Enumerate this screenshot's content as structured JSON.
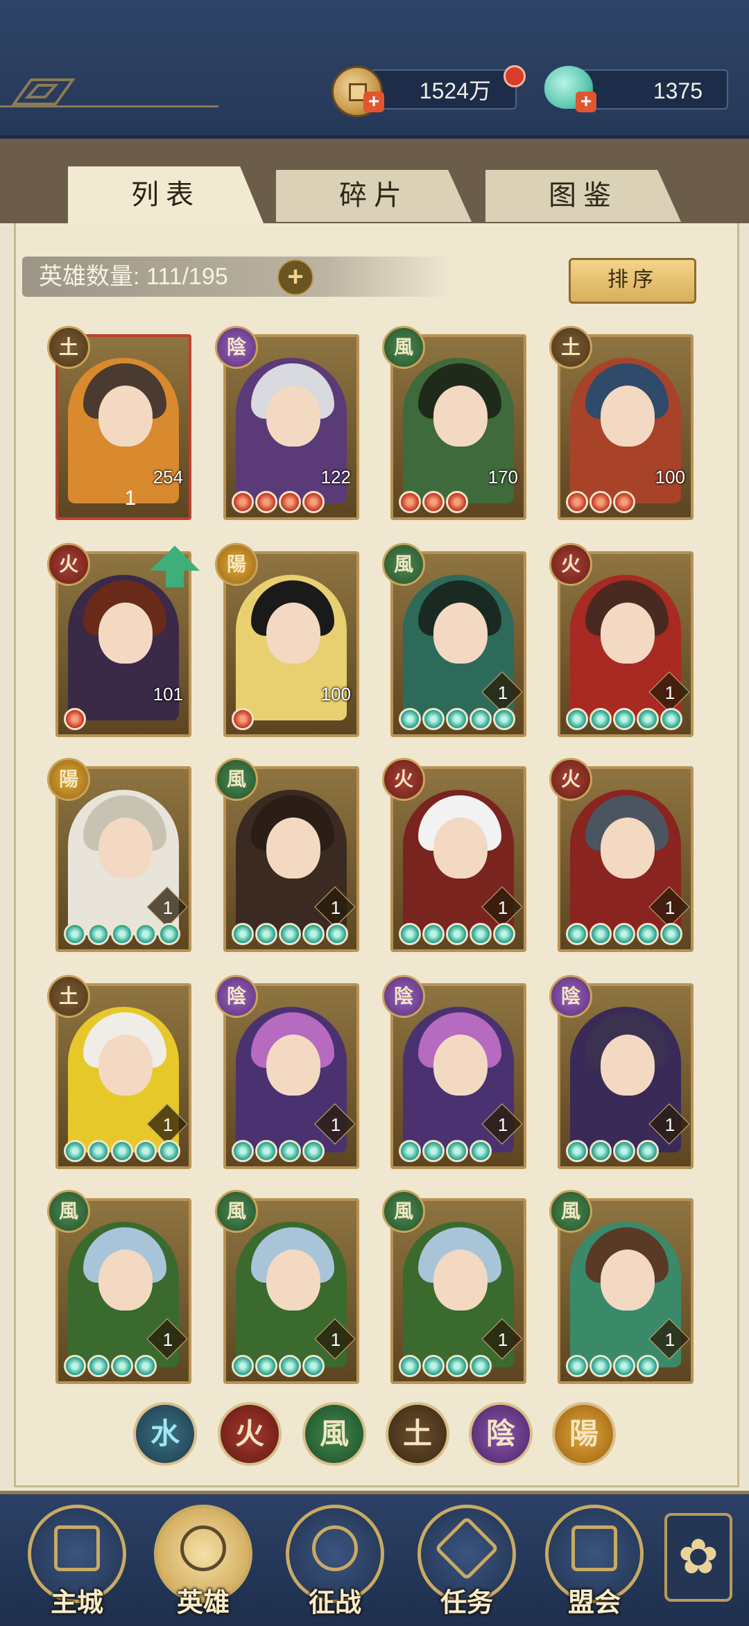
{
  "currency": {
    "coins": "1524万",
    "gems": "1375"
  },
  "tabs": [
    {
      "label": "列表",
      "active": true
    },
    {
      "label": "碎片",
      "active": false
    },
    {
      "label": "图鉴",
      "active": false
    }
  ],
  "hero_count": {
    "label": "英雄数量: 111/195"
  },
  "sort_button": {
    "label": "排序"
  },
  "elements": {
    "earth": "土",
    "yin": "陰",
    "wind": "風",
    "fire": "火",
    "yang": "陽",
    "water": "水"
  },
  "heroes": [
    {
      "element": "土",
      "level": "254",
      "stars": "1",
      "beads": [],
      "red_frame": true
    },
    {
      "element": "陰",
      "level": "122",
      "stars": "",
      "beads": [
        "red",
        "red",
        "red",
        "red"
      ]
    },
    {
      "element": "風",
      "level": "170",
      "stars": "",
      "beads": [
        "red",
        "red",
        "red"
      ]
    },
    {
      "element": "土",
      "level": "100",
      "stars": "",
      "beads": [
        "red",
        "red",
        "red"
      ]
    },
    {
      "element": "火",
      "level": "101",
      "stars": "",
      "beads": [
        "red"
      ],
      "upgrade": true
    },
    {
      "element": "陽",
      "level": "100",
      "stars": "",
      "beads": [
        "red"
      ]
    },
    {
      "element": "風",
      "level": "",
      "stars": "1",
      "beads": [
        "green",
        "green",
        "green",
        "green",
        "green"
      ]
    },
    {
      "element": "火",
      "level": "",
      "stars": "1",
      "beads": [
        "green",
        "green",
        "green",
        "green",
        "green"
      ]
    },
    {
      "element": "陽",
      "level": "",
      "stars": "1",
      "beads": [
        "green",
        "green",
        "green",
        "green",
        "green"
      ]
    },
    {
      "element": "風",
      "level": "",
      "stars": "1",
      "beads": [
        "green",
        "green",
        "green",
        "green",
        "green"
      ]
    },
    {
      "element": "火",
      "level": "",
      "stars": "1",
      "beads": [
        "green",
        "green",
        "green",
        "green",
        "green"
      ]
    },
    {
      "element": "火",
      "level": "",
      "stars": "1",
      "beads": [
        "green",
        "green",
        "green",
        "green",
        "green"
      ]
    },
    {
      "element": "土",
      "level": "",
      "stars": "1",
      "beads": [
        "green",
        "green",
        "green",
        "green",
        "green"
      ]
    },
    {
      "element": "陰",
      "level": "",
      "stars": "1",
      "beads": [
        "green",
        "green",
        "green",
        "green"
      ]
    },
    {
      "element": "陰",
      "level": "",
      "stars": "1",
      "beads": [
        "green",
        "green",
        "green",
        "green"
      ]
    },
    {
      "element": "陰",
      "level": "",
      "stars": "1",
      "beads": [
        "green",
        "green",
        "green",
        "green"
      ]
    },
    {
      "element": "風",
      "level": "",
      "stars": "1",
      "beads": [
        "green",
        "green",
        "green",
        "green"
      ]
    },
    {
      "element": "風",
      "level": "",
      "stars": "1",
      "beads": [
        "green",
        "green",
        "green",
        "green"
      ]
    },
    {
      "element": "風",
      "level": "",
      "stars": "1",
      "beads": [
        "green",
        "green",
        "green",
        "green"
      ]
    },
    {
      "element": "風",
      "level": "",
      "stars": "1",
      "beads": [
        "green",
        "green",
        "green",
        "green"
      ]
    }
  ],
  "filters": [
    "水",
    "火",
    "風",
    "土",
    "陰",
    "陽"
  ],
  "bottom_nav": [
    {
      "label": "主城",
      "active": false
    },
    {
      "label": "英雄",
      "active": true
    },
    {
      "label": "征战",
      "active": false
    },
    {
      "label": "任务",
      "active": false
    },
    {
      "label": "盟会",
      "active": false
    }
  ],
  "colors": {
    "panel": "#efe7d0",
    "topbar": "#2f4468",
    "bead_red": "#c8301e",
    "bead_green": "#1b9c8a"
  }
}
